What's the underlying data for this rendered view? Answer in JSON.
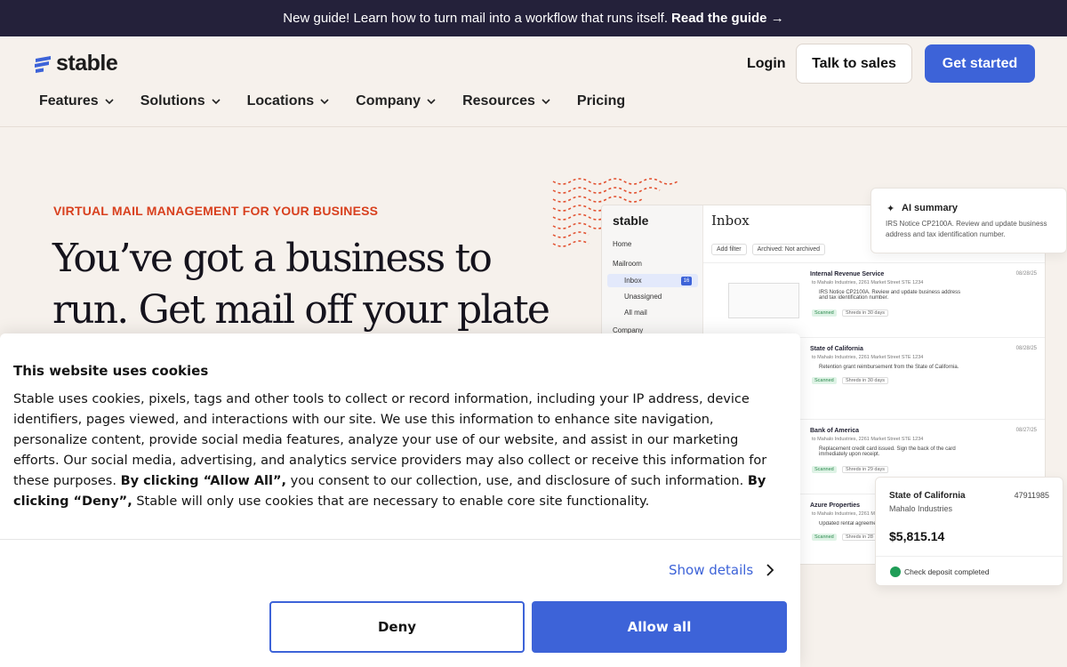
{
  "announcement": {
    "text": "New guide! Learn how to turn mail into a workflow that runs itself.",
    "link": "Read the guide →"
  },
  "header": {
    "logo_text": "stable",
    "login": "Login",
    "talk_to_sales": "Talk to sales",
    "get_started": "Get started",
    "nav": [
      "Features",
      "Solutions",
      "Locations",
      "Company",
      "Resources",
      "Pricing"
    ]
  },
  "hero": {
    "eyebrow": "VIRTUAL MAIL MANAGEMENT FOR YOUR BUSINESS",
    "headline": "You’ve got a business to run. Get mail off your plate"
  },
  "mock": {
    "logo": "stable",
    "title": "Inbox",
    "sidebar": [
      "Home",
      "Mailroom",
      "Inbox",
      "Unassigned",
      "All mail",
      "Company"
    ],
    "inbox_count": "16",
    "filters": [
      "Add filter",
      "Archived: Not archived"
    ],
    "rows": [
      {
        "title": "Internal Revenue Service",
        "sub": "to Mahalo Industries, 2261 Market Street STE 1234",
        "desc": "IRS Notice CP2100A. Review and update business address and tax identification number.",
        "tag": "Scanned",
        "note": "Shreds in 30 days",
        "date": "08/28/25"
      },
      {
        "title": "State of California",
        "sub": "to Mahalo Industries, 2261 Market Street STE 1234",
        "desc": "Retention grant reimbursement from the State of California.",
        "tag": "Scanned",
        "note": "Shreds in 30 days",
        "date": "08/28/25"
      },
      {
        "title": "Bank of America",
        "sub": "to Mahalo Industries, 2261 Market Street STE 1234",
        "desc": "Replacement credit card issued. Sign the back of the card immediately upon receipt.",
        "tag": "Scanned",
        "note": "Shreds in 29 days",
        "date": "08/27/25"
      },
      {
        "title": "Azure Properties",
        "sub": "to Mahalo Industries, 2261 Market Street STE 1234",
        "desc": "Updated rental agreement",
        "tag": "Scanned",
        "note": "Shreds in 28",
        "date": ""
      }
    ]
  },
  "ai_summary": {
    "title": "AI summary",
    "body": "IRS Notice CP2100A. Review and update business address and tax identification number."
  },
  "deposit": {
    "name": "State of California",
    "number": "47911985",
    "company": "Mahalo Industries",
    "amount": "$5,815.14",
    "status": "Check deposit completed"
  },
  "cookie": {
    "title": "This website uses cookies",
    "body_1": "Stable uses cookies, pixels, tags and other tools to collect or record information, including your IP address, device identifiers, pages viewed, and interactions with our site. We use this information to enhance site navigation, personalize content, provide social media features, analyze your use of our website, and assist in our marketing efforts. Our social media, advertising, and analytics service providers may also collect or receive this information for these purposes.",
    "bold_1": "By clicking “Allow All”,",
    "body_2": "you consent to our collection, use, and disclosure of such information.",
    "bold_2": "By clicking “Deny”,",
    "body_3": "Stable will only use cookies that are necessary to enable core site functionality.",
    "show_details": "Show details",
    "deny": "Deny",
    "allow_all": "Allow all"
  },
  "colors": {
    "accent": "#3d63d8",
    "announcement_bg": "#24213a",
    "eyebrow": "#d8401e",
    "page_bg": "#f6f1ec"
  }
}
